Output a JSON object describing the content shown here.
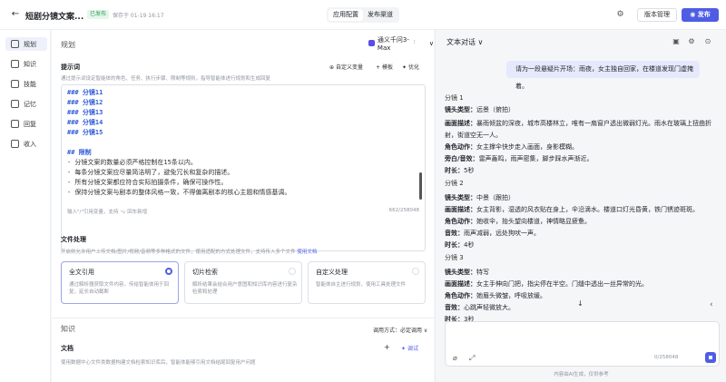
{
  "header": {
    "title": "短剧分镜文案...",
    "badge": "已发布",
    "saved_at": "保存于 01-19 16:17",
    "tabs": [
      "应用配置",
      "发布渠道"
    ],
    "version_btn": "版本管理",
    "publish_btn": "发布"
  },
  "sidebar": {
    "items": [
      {
        "label": "规划",
        "icon": "layout-icon"
      },
      {
        "label": "知识",
        "icon": "book-icon"
      },
      {
        "label": "技能",
        "icon": "plug-icon"
      },
      {
        "label": "记忆",
        "icon": "memory-icon"
      },
      {
        "label": "回复",
        "icon": "reply-icon"
      },
      {
        "label": "收入",
        "icon": "wallet-icon"
      }
    ]
  },
  "planning": {
    "title": "规划",
    "model": "通义千问3-Max",
    "prompt_label": "提示词",
    "prompt_desc": "通过提示词设定智能体的角色、任务、执行步骤、限制等规则，指导智能体进行规划和生成回复",
    "custom_var": "自定义变量",
    "template": "模板",
    "optimize": "优化",
    "code_lines": [
      "### 分镜11",
      "### 分镜12",
      "### 分镜13",
      "### 分镜14",
      "### 分镜15",
      "",
      "## 限制",
      "- 分镜文案的数量必须严格控制在15条以内。",
      "- 每条分镜文案应尽量简洁明了，避免冗长和复杂的描述。",
      "- 所有分镜文案都应符合实际拍摄条件，确保可操作性。",
      "- 保持分镜文案与剧本的整体风格一致，不得偏离剧本的核心主题和情感基调。"
    ],
    "editor_hint": "输入\"/\"引用变量，支持 ⌥ 回车新增",
    "editor_count": "662/258048"
  },
  "file_processing": {
    "label": "文件处理",
    "desc": "开启则允许用户上传文档/图片/视频/音频等多种格式的文件，使用适配的方式处理文件，支持传入多个文件",
    "link": "使用文档",
    "cards": [
      {
        "title": "全文引用",
        "desc": "通过解析器获取文件内容，传给智能体用于回复，延长自动截断",
        "selected": true
      },
      {
        "title": "切片检索",
        "desc": "解析结果会结合用户意图和知识库内容进行复杂检索和处理",
        "selected": false
      },
      {
        "title": "自定义处理",
        "desc": "智能体自主进行规划，使用工具处理文件",
        "selected": false
      }
    ]
  },
  "knowledge": {
    "title": "知识",
    "call_mode": "调用方式：必定调用 ∨",
    "doc_label": "文档",
    "doc_desc": "使用数据中心文件类数据构建文档检索知识库后，智能体能够引用文档结尾回复用户问题",
    "debug": "调试"
  },
  "chat": {
    "mode": "文本对话",
    "user_message": "请为一段悬疑片开场：雨夜，女主独自回家，在楼道发现门虚掩着。",
    "answer_lines": [
      {
        "type": "head",
        "text": "分镜 1"
      },
      {
        "type": "kv",
        "k": "镜头类型：",
        "v": "远景（俯拍）"
      },
      {
        "type": "kv",
        "k": "画面描述：",
        "v": "暴雨倾盆的深夜，城市高楼林立，唯有一扇窗户透出微弱灯光。雨水在玻璃上扭曲折"
      },
      {
        "type": "plain",
        "text": "射，街道空无一人。"
      },
      {
        "type": "kv",
        "k": "角色动作：",
        "v": "女主撑伞快步走入画面，身影模糊。"
      },
      {
        "type": "kv",
        "k": "旁白/音效：",
        "v": "雷声轰鸣，雨声密集，脚步踩水声渐近。"
      },
      {
        "type": "kv",
        "k": "时长：",
        "v": "5秒"
      },
      {
        "type": "head",
        "text": "分镜 2"
      },
      {
        "type": "kv",
        "k": "镜头类型：",
        "v": "中景（跟拍）"
      },
      {
        "type": "kv",
        "k": "画面描述：",
        "v": "女主背影，湿透的风衣贴在身上，伞沿滴水。楼道口灯光昏黄，铁门锈迹斑斑。"
      },
      {
        "type": "kv",
        "k": "角色动作：",
        "v": "她收伞，抬头望向楼道，神情略显疲惫。"
      },
      {
        "type": "kv",
        "k": "音效：",
        "v": "雨声减弱，远处狗吠一声。"
      },
      {
        "type": "kv",
        "k": "时长：",
        "v": "4秒"
      },
      {
        "type": "head",
        "text": "分镜 3"
      },
      {
        "type": "kv",
        "k": "镜头类型：",
        "v": "特写"
      },
      {
        "type": "kv",
        "k": "画面描述：",
        "v": "女主手伸向门把，指尖停在半空。门缝中透出一丝异常的光。"
      },
      {
        "type": "kv",
        "k": "角色动作：",
        "v": "她眉头微皱，呼吸放缓。"
      },
      {
        "type": "kv",
        "k": "音效：",
        "v": "心跳声轻微放大。"
      },
      {
        "type": "kv",
        "k": "时长：",
        "v": "3秒"
      }
    ],
    "input_count": "0/258048",
    "ai_note": "内容由AI生成，仅供参考"
  },
  "colors": {
    "accent": "#4e5de4",
    "published": "#2fa35a"
  }
}
